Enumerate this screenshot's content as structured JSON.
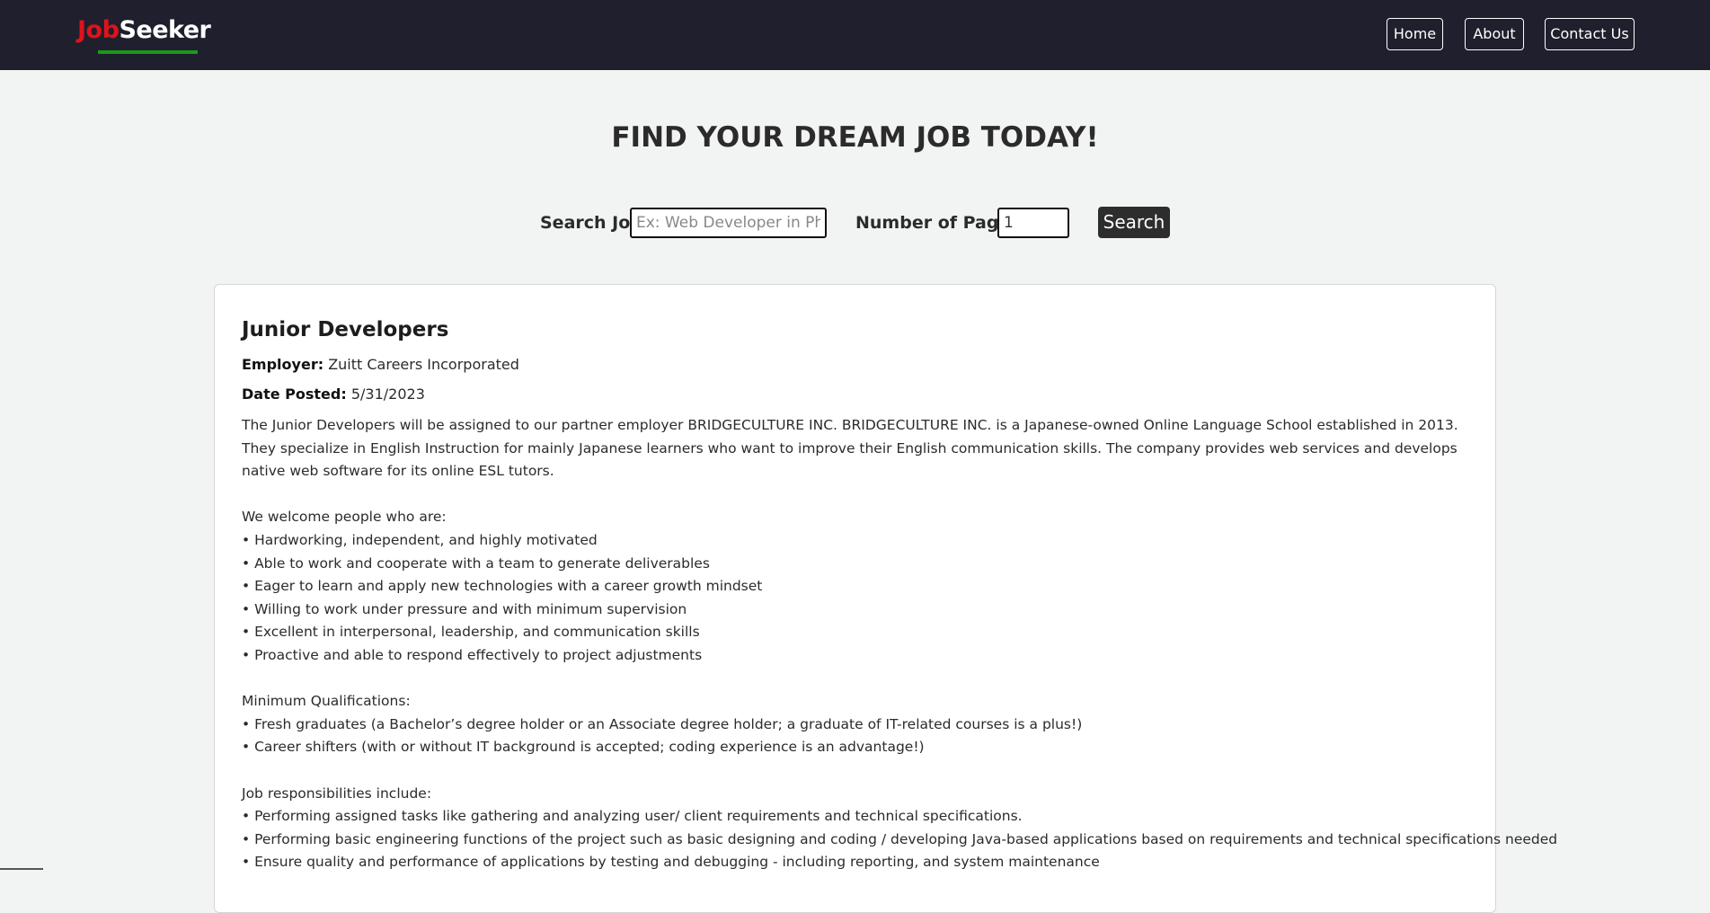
{
  "brand": {
    "part1": "Job",
    "part2": "Seeker"
  },
  "nav": {
    "home": "Home",
    "about": "About",
    "contact": "Contact Us"
  },
  "headline": "FIND YOUR DREAM JOB TODAY!",
  "search": {
    "job_label": "Search Job",
    "job_placeholder": "Ex: Web Developer in Phil",
    "pages_label": "Number of Pages",
    "pages_value": "1",
    "button": "Search"
  },
  "job": {
    "title": "Junior Developers",
    "employer_label": "Employer:",
    "employer": "Zuitt Careers Incorporated",
    "date_label": "Date Posted:",
    "date": "5/31/2023",
    "intro": "The Junior Developers will be assigned to our partner employer BRIDGECULTURE INC. BRIDGECULTURE INC. is a Japanese-owned Online Language School established in 2013. They specialize in English Instruction for mainly Japanese learners who want to improve their English communication skills. The company provides web services and develops native web software for its online ESL tutors.",
    "welcome_heading": "We welcome people who are:",
    "welcome": [
      "• Hardworking, independent, and highly motivated",
      "• Able to work and cooperate with a team to generate deliverables",
      "• Eager to learn and apply new technologies with a career growth mindset",
      "• Willing to work under pressure and with minimum supervision",
      "• Excellent in interpersonal, leadership, and communication skills",
      "• Proactive and able to respond effectively to project adjustments"
    ],
    "qual_heading": "Minimum Qualifications:",
    "qual": [
      "• Fresh graduates (a Bachelor’s degree holder or an Associate degree holder; a graduate of IT-related courses is a plus!)",
      "• Career shifters (with or without IT background is accepted; coding experience is an advantage!)"
    ],
    "resp_heading": "Job responsibilities include:",
    "resp": [
      "• Performing assigned tasks like gathering and analyzing user/ client requirements and technical specifications.",
      "• Performing basic engineering functions of the project such as basic designing and coding / developing Java-based applications based on requirements and technical specifications needed",
      "• Ensure quality and performance of applications by testing and debugging - including reporting, and system maintenance"
    ]
  }
}
